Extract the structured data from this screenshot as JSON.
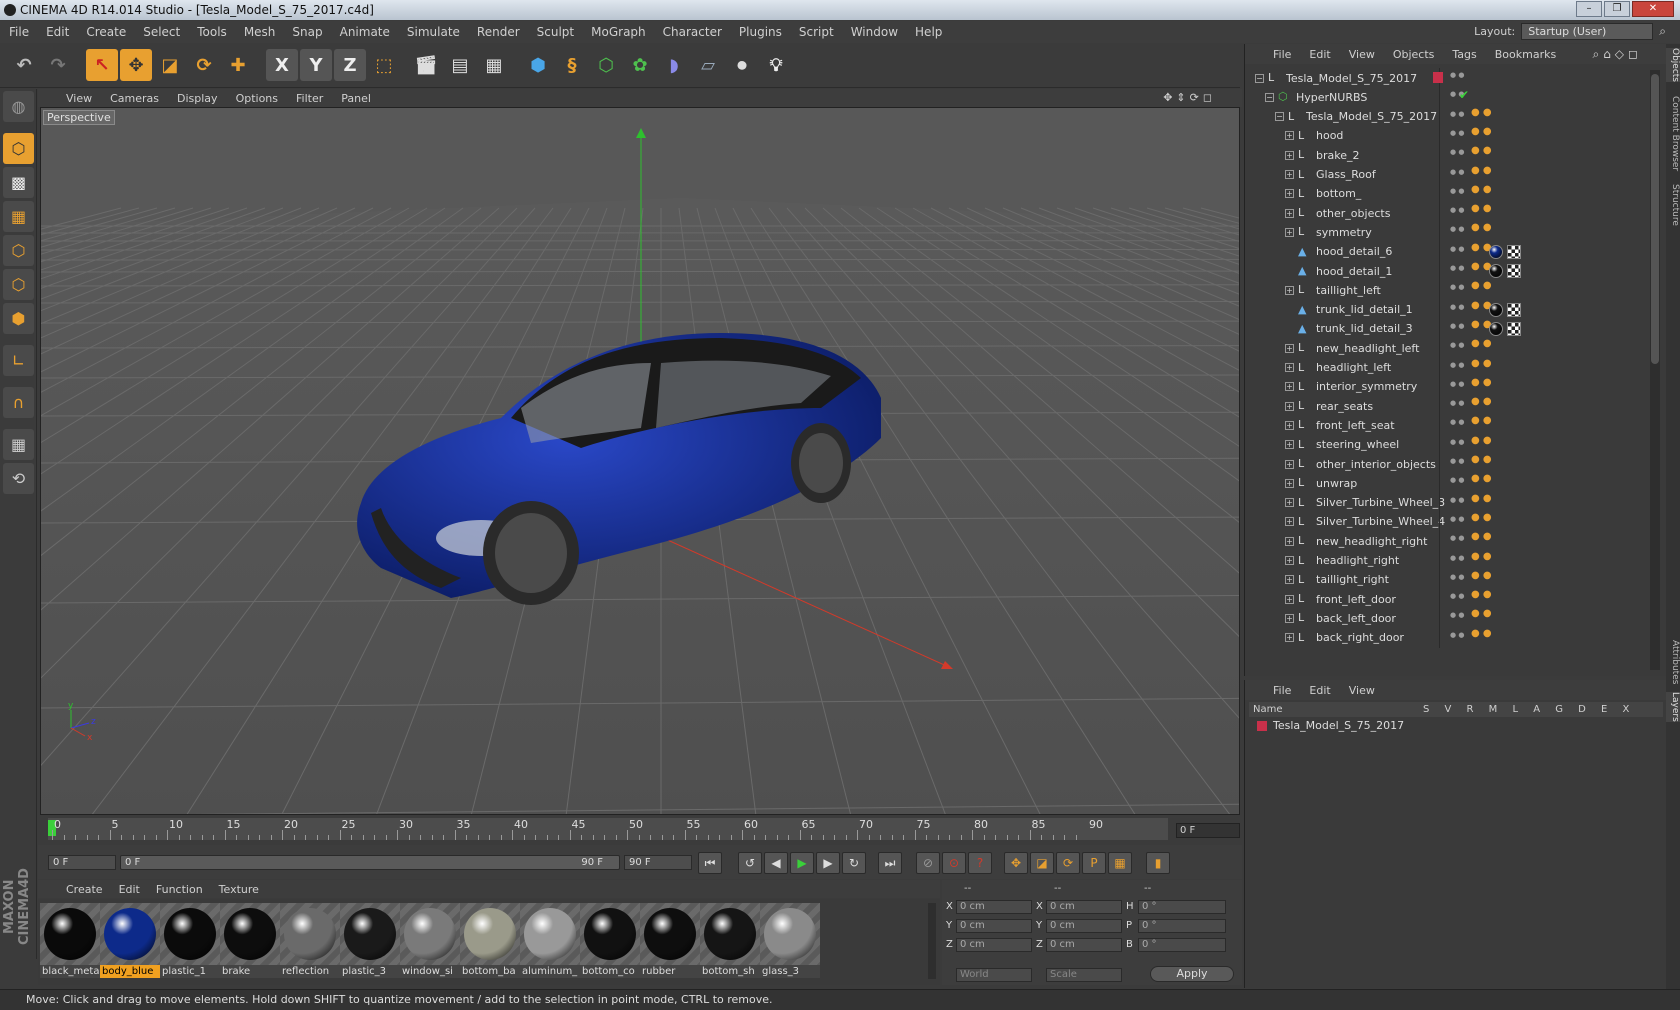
{
  "window": {
    "title": "CINEMA 4D R14.014 Studio - [Tesla_Model_S_75_2017.c4d]"
  },
  "menu": [
    "File",
    "Edit",
    "Create",
    "Select",
    "Tools",
    "Mesh",
    "Snap",
    "Animate",
    "Simulate",
    "Render",
    "Sculpt",
    "MoGraph",
    "Character",
    "Plugins",
    "Script",
    "Window",
    "Help"
  ],
  "layout": {
    "label": "Layout:",
    "value": "Startup (User)"
  },
  "toolbar": {
    "x_label": "X",
    "y_label": "Y",
    "z_label": "Z"
  },
  "viewport": {
    "menu": [
      "View",
      "Cameras",
      "Display",
      "Options",
      "Filter",
      "Panel"
    ],
    "label": "Perspective",
    "car_color": "#10288a"
  },
  "timeline": {
    "ticks": [
      "0",
      "5",
      "10",
      "15",
      "20",
      "25",
      "30",
      "35",
      "40",
      "45",
      "50",
      "55",
      "60",
      "65",
      "70",
      "75",
      "80",
      "85",
      "90"
    ],
    "frame": "0 F"
  },
  "transport": {
    "start": "0 F",
    "range_start": "0 F",
    "range_end": "90 F",
    "end": "90 F"
  },
  "materials": {
    "menu": [
      "Create",
      "Edit",
      "Function",
      "Texture"
    ],
    "items": [
      {
        "name": "black_meta",
        "color": "#0a0a0a"
      },
      {
        "name": "body_blue",
        "color": "#0d2a8a",
        "selected": true
      },
      {
        "name": "plastic_1",
        "color": "#0b0b0b"
      },
      {
        "name": "brake",
        "color": "#0d0d0d"
      },
      {
        "name": "reflection",
        "color": "#6a6a6a"
      },
      {
        "name": "plastic_3",
        "color": "#1a1a1a"
      },
      {
        "name": "window_si",
        "color": "#7a7a7a"
      },
      {
        "name": "bottom_ba",
        "color": "#9a9a8a"
      },
      {
        "name": "aluminum_",
        "color": "#999999"
      },
      {
        "name": "bottom_co",
        "color": "#111111"
      },
      {
        "name": "rubber",
        "color": "#0e0e0e"
      },
      {
        "name": "bottom_sh",
        "color": "#151515"
      },
      {
        "name": "glass_3",
        "color": "#8a8a8a"
      }
    ]
  },
  "coords": {
    "headers": [
      "--",
      "--",
      "--"
    ],
    "rows": [
      {
        "a": "X",
        "av": "0 cm",
        "b": "X",
        "bv": "0 cm",
        "c": "H",
        "cv": "0 °"
      },
      {
        "a": "Y",
        "av": "0 cm",
        "b": "Y",
        "bv": "0 cm",
        "c": "P",
        "cv": "0 °"
      },
      {
        "a": "Z",
        "av": "0 cm",
        "b": "Z",
        "bv": "0 cm",
        "c": "B",
        "cv": "0 °"
      }
    ],
    "mode": "World",
    "scale": "Scale",
    "apply": "Apply"
  },
  "objects": {
    "menu": [
      "File",
      "Edit",
      "View",
      "Objects",
      "Tags",
      "Bookmarks"
    ],
    "items": [
      {
        "name": "Tesla_Model_S_75_2017",
        "indent": 0,
        "type": "null"
      },
      {
        "name": "HyperNURBS",
        "indent": 1,
        "type": "nurbs"
      },
      {
        "name": "Tesla_Model_S_75_2017",
        "indent": 2,
        "type": "null"
      },
      {
        "name": "hood",
        "indent": 3,
        "type": "null"
      },
      {
        "name": "brake_2",
        "indent": 3,
        "type": "null"
      },
      {
        "name": "Glass_Roof",
        "indent": 3,
        "type": "null"
      },
      {
        "name": "bottom_",
        "indent": 3,
        "type": "null"
      },
      {
        "name": "other_objects",
        "indent": 3,
        "type": "null"
      },
      {
        "name": "symmetry",
        "indent": 3,
        "type": "null"
      },
      {
        "name": "hood_detail_6",
        "indent": 3,
        "type": "poly",
        "mat": "#0d2a8a"
      },
      {
        "name": "hood_detail_1",
        "indent": 3,
        "type": "poly",
        "mat": "#111111"
      },
      {
        "name": "taillight_left",
        "indent": 3,
        "type": "null"
      },
      {
        "name": "trunk_lid_detail_1",
        "indent": 3,
        "type": "poly",
        "mat": "#111111"
      },
      {
        "name": "trunk_lid_detail_3",
        "indent": 3,
        "type": "poly",
        "mat": "#111111"
      },
      {
        "name": "new_headlight_left",
        "indent": 3,
        "type": "null"
      },
      {
        "name": "headlight_left",
        "indent": 3,
        "type": "null"
      },
      {
        "name": "interior_symmetry",
        "indent": 3,
        "type": "null"
      },
      {
        "name": "rear_seats",
        "indent": 3,
        "type": "null"
      },
      {
        "name": "front_left_seat",
        "indent": 3,
        "type": "null"
      },
      {
        "name": "steering_wheel",
        "indent": 3,
        "type": "null"
      },
      {
        "name": "other_interior_objects",
        "indent": 3,
        "type": "null"
      },
      {
        "name": "unwrap",
        "indent": 3,
        "type": "null"
      },
      {
        "name": "Silver_Turbine_Wheel_3",
        "indent": 3,
        "type": "null"
      },
      {
        "name": "Silver_Turbine_Wheel_4",
        "indent": 3,
        "type": "null"
      },
      {
        "name": "new_headlight_right",
        "indent": 3,
        "type": "null"
      },
      {
        "name": "headlight_right",
        "indent": 3,
        "type": "null"
      },
      {
        "name": "taillight_right",
        "indent": 3,
        "type": "null"
      },
      {
        "name": "front_left_door",
        "indent": 3,
        "type": "null"
      },
      {
        "name": "back_left_door",
        "indent": 3,
        "type": "null"
      },
      {
        "name": "back_right_door",
        "indent": 3,
        "type": "null"
      }
    ]
  },
  "layers": {
    "menu": [
      "File",
      "Edit",
      "View"
    ],
    "col_name": "Name",
    "cols": "S V R M L A G D E X",
    "row": "Tesla_Model_S_75_2017"
  },
  "sidetabs": [
    "Objects",
    "Content Browser",
    "Structure",
    "Attributes",
    "Layers"
  ],
  "status": "Move: Click and drag to move elements. Hold down SHIFT to quantize movement / add to the selection in point mode, CTRL to remove.",
  "colors": {
    "accent": "#f0a020",
    "selected_bg": "#f0a020"
  }
}
